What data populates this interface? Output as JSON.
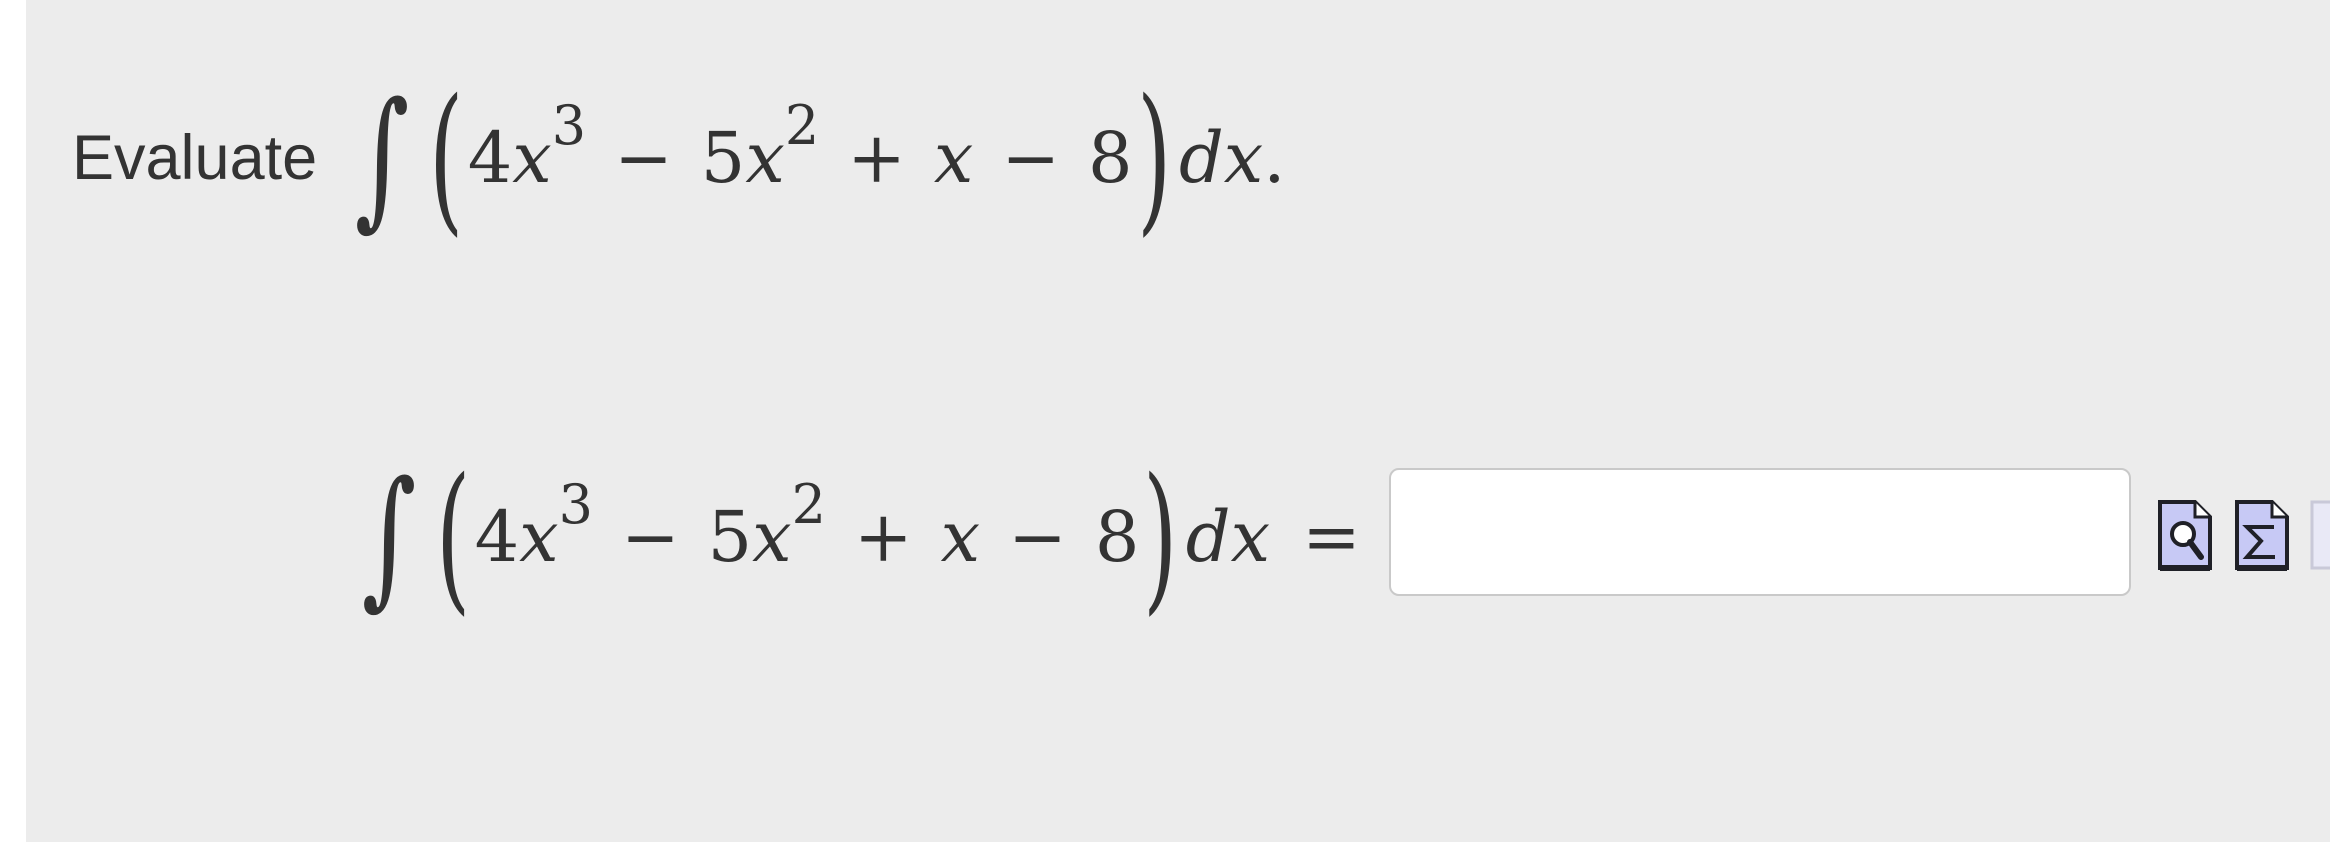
{
  "problem": {
    "prompt_word": "Evaluate",
    "integral_symbol": "∫",
    "left_paren": "(",
    "right_paren": ")",
    "term1_coef": "4",
    "var": "x",
    "exp1": "3",
    "op1": "−",
    "term2_coef": "5",
    "exp2": "2",
    "op2": "+",
    "op3": "−",
    "constant": "8",
    "differential": "dx",
    "period": "."
  },
  "answer": {
    "equals": "=",
    "value": "",
    "placeholder": ""
  },
  "tools": [
    {
      "icon": "preview-magnifier-icon"
    },
    {
      "icon": "equation-editor-sigma-icon"
    },
    {
      "icon": "help-icon"
    }
  ],
  "colors": {
    "panel_bg": "#ececec",
    "text": "#333333",
    "icon_fill": "#c7c9f5",
    "icon_stroke": "#1f2027"
  }
}
